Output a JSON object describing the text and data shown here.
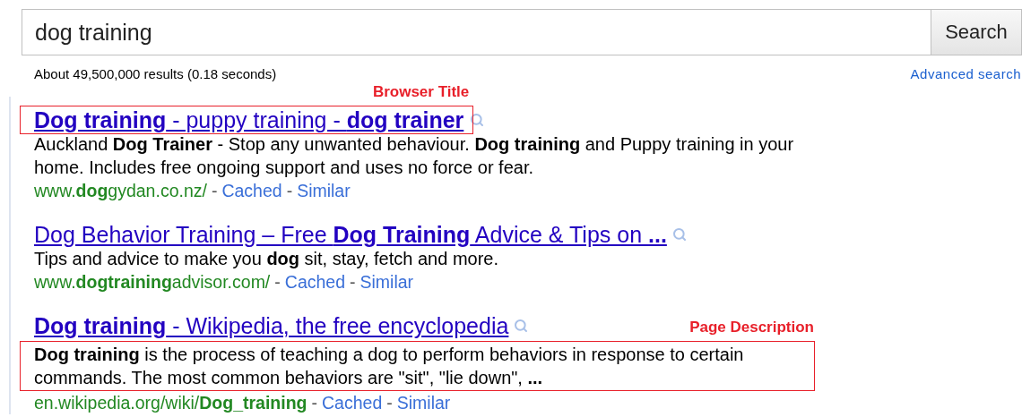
{
  "search": {
    "value": "dog training",
    "button": "Search"
  },
  "stats": "About 49,500,000 results (0.18 seconds)",
  "advanced_link": "Advanced search",
  "results": [
    {
      "title": "**Dog training** - puppy training - **dog trainer**",
      "snippet": "Auckland **Dog Trainer** - Stop any unwanted behaviour. **Dog training** and Puppy training in your home. Includes free ongoing support and uses no force or fear.",
      "url": "www.**dog**gydan.co.nz/",
      "links": [
        "Cached",
        "Similar"
      ],
      "separator": "-",
      "title_callout": "Browser Title"
    },
    {
      "title": "Dog Behavior Training – Free **Dog Training** Advice & Tips on **...**",
      "snippet": "Tips and advice to make you **dog** sit, stay, fetch and more.",
      "url": "www.**dogtraining**advisor.com/",
      "links": [
        "Cached",
        "Similar"
      ],
      "separator": "-"
    },
    {
      "title": "**Dog training** - Wikipedia, the free encyclopedia",
      "snippet": "**Dog training** is the process of teaching a dog to perform behaviors in response to certain commands. The most common behaviors are \"sit\", \"lie down\", **...**",
      "url": "en.wikipedia.org/wiki/**Dog_training**",
      "links": [
        "Cached",
        "Similar"
      ],
      "separator": "-",
      "snippet_callout": "Page Description"
    }
  ]
}
